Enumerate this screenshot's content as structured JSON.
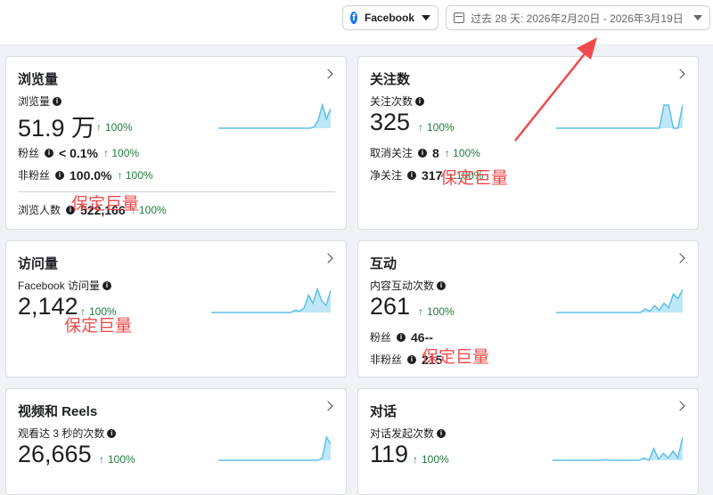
{
  "toolbar": {
    "platform": "Facebook",
    "platform_logo": "f",
    "date_range": "过去 28 天: 2026年2月20日 - 2026年3月19日"
  },
  "info_glyph": "i",
  "up_arrow": "↑",
  "watermark": "保定巨量",
  "cards": {
    "views": {
      "title": "浏览量",
      "metric_label": "浏览量",
      "value": "51.9 万",
      "trend": "100%",
      "rows": [
        {
          "label": "粉丝",
          "value": "< 0.1%",
          "trend": "100%"
        },
        {
          "label": "非粉丝",
          "value": "100.0%",
          "trend": "100%"
        }
      ],
      "reach": {
        "label": "浏览人数",
        "value": "522,166",
        "trend": "100%"
      }
    },
    "follows": {
      "title": "关注数",
      "metric_label": "关注次数",
      "value": "325",
      "trend": "100%",
      "rows": [
        {
          "label": "取消关注",
          "value": "8",
          "trend": "100%"
        },
        {
          "label": "净关注",
          "value": "317",
          "trend": "100%"
        }
      ]
    },
    "visits": {
      "title": "访问量",
      "metric_label": "Facebook 访问量",
      "value": "2,142",
      "trend": "100%"
    },
    "interactions": {
      "title": "互动",
      "metric_label": "内容互动次数",
      "value": "261",
      "trend": "100%",
      "rows": [
        {
          "label": "粉丝",
          "value": "46--"
        },
        {
          "label": "非粉丝",
          "value": "215"
        }
      ]
    },
    "video": {
      "title": "视频和 Reels",
      "metric_label": "观看达 3 秒的次数",
      "value": "26,665",
      "trend": "100%"
    },
    "conversations": {
      "title": "对话",
      "metric_label": "对话发起次数",
      "value": "119",
      "trend": "100%"
    }
  },
  "colors": {
    "spark_line": "#5bc0eb",
    "spark_fill": "#bfe7f8",
    "trend": "#1e7a3e",
    "annotation": "#ef4b4b"
  },
  "spark_data": {
    "views": [
      0,
      0,
      0,
      0,
      0,
      0,
      0,
      0,
      0,
      0,
      0,
      0,
      0,
      0,
      0,
      0,
      0,
      0,
      0,
      0,
      0,
      0,
      0,
      0.05,
      0.35,
      1,
      0.4,
      0.85
    ],
    "follows": [
      0,
      0,
      0,
      0,
      0,
      0,
      0,
      0,
      0,
      0,
      0,
      0,
      0,
      0,
      0,
      0,
      0,
      0,
      0,
      0,
      0,
      0,
      0,
      1,
      1,
      0,
      0,
      1
    ],
    "visits": [
      0,
      0,
      0,
      0,
      0,
      0,
      0,
      0,
      0,
      0,
      0,
      0,
      0,
      0,
      0,
      0,
      0,
      0,
      0,
      0.1,
      0.05,
      0.2,
      0.75,
      0.4,
      1,
      0.5,
      0.3,
      0.95
    ],
    "interactions": [
      0,
      0,
      0,
      0,
      0,
      0,
      0,
      0,
      0,
      0,
      0,
      0,
      0,
      0,
      0,
      0,
      0,
      0,
      0,
      0.15,
      0.05,
      0.3,
      0.1,
      0.4,
      0.2,
      0.8,
      0.6,
      1
    ],
    "video": [
      0,
      0,
      0,
      0,
      0,
      0,
      0,
      0,
      0,
      0,
      0,
      0,
      0,
      0,
      0,
      0,
      0,
      0,
      0,
      0,
      0,
      0,
      0,
      0,
      0,
      0.1,
      1,
      0.7
    ],
    "conversations": [
      0,
      0,
      0,
      0,
      0,
      0,
      0,
      0,
      0,
      0,
      0,
      0.03,
      0,
      0,
      0,
      0,
      0,
      0,
      0,
      0.1,
      0,
      0.5,
      0.05,
      0.3,
      0.1,
      0.4,
      0.1,
      1
    ]
  }
}
